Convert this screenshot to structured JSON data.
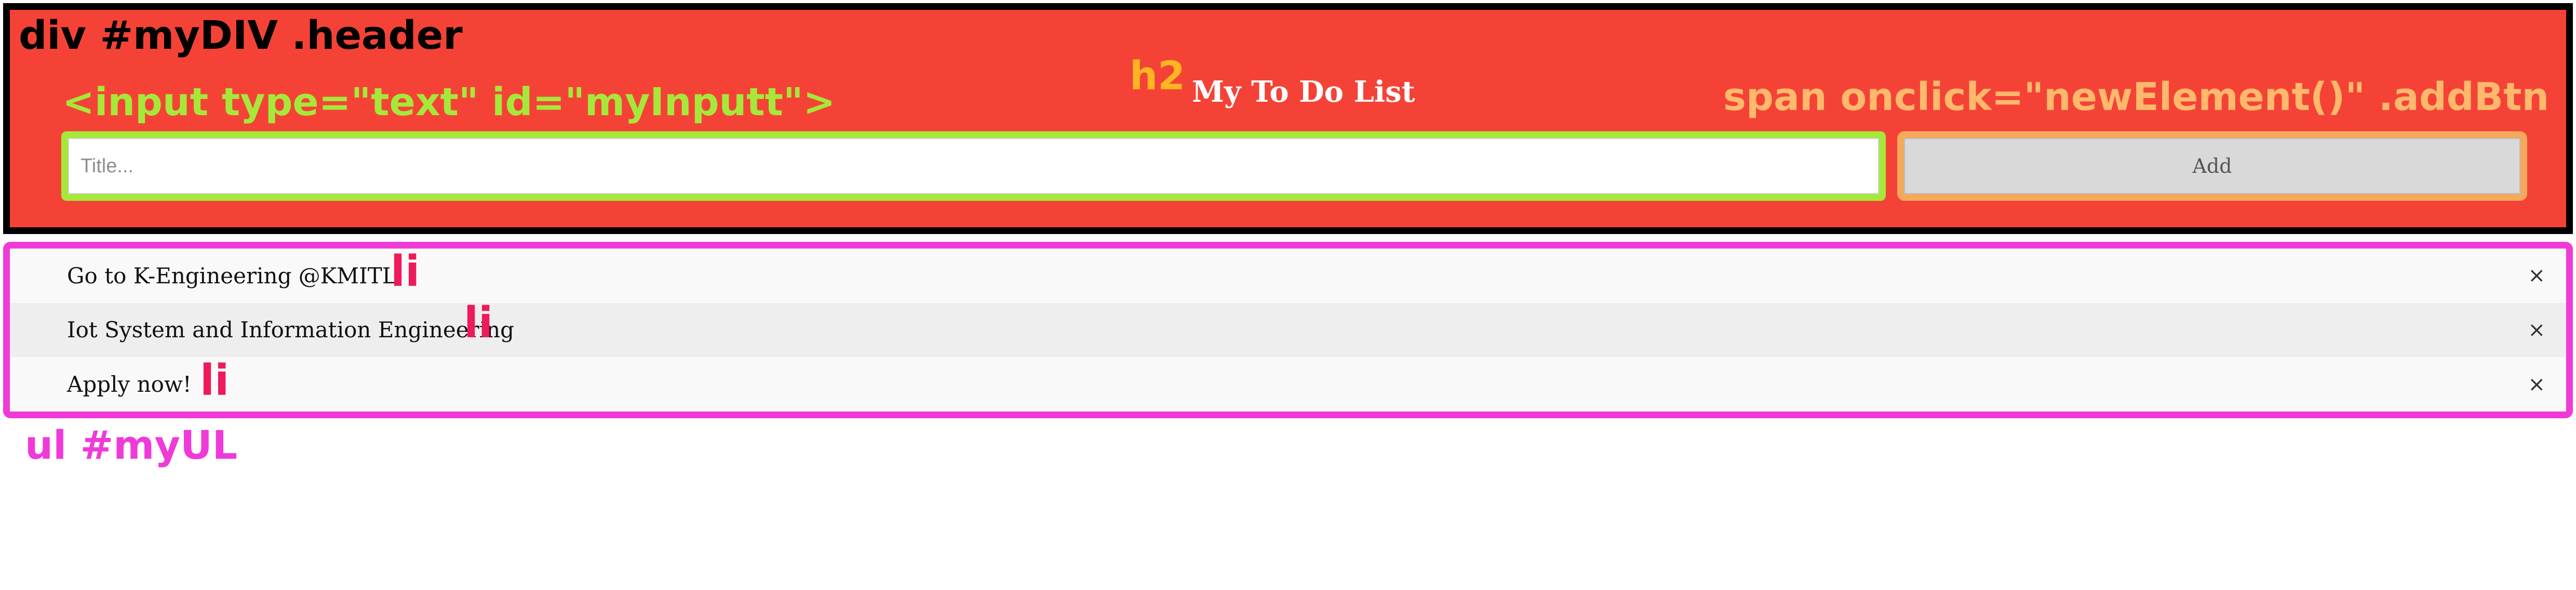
{
  "annotations": {
    "header_div": "div #myDIV .header",
    "input_tag": "<input type=\"text\" id=\"myInputt\">",
    "h2_tag": "h2",
    "span_tag": "span onclick=\"newElement()\" .addBtn",
    "li_tag": "li",
    "ul_tag": "ul #myUL"
  },
  "header": {
    "title": "My To Do List",
    "input_placeholder": "Title...",
    "input_value": "",
    "add_label": "Add"
  },
  "list": {
    "items": [
      {
        "text": "Go to K-Engineering @KMITL",
        "close": "×"
      },
      {
        "text": "Iot System and Information Engineering",
        "close": "×"
      },
      {
        "text": "Apply now!",
        "close": "×"
      }
    ]
  },
  "colors": {
    "header_bg": "#f44336",
    "header_outline": "#000000",
    "input_outline": "#a6e83a",
    "button_outline": "#f5a95a",
    "list_outline": "#f03ad8",
    "li_label": "#ee1a5a",
    "h2_label": "#ffb522"
  }
}
